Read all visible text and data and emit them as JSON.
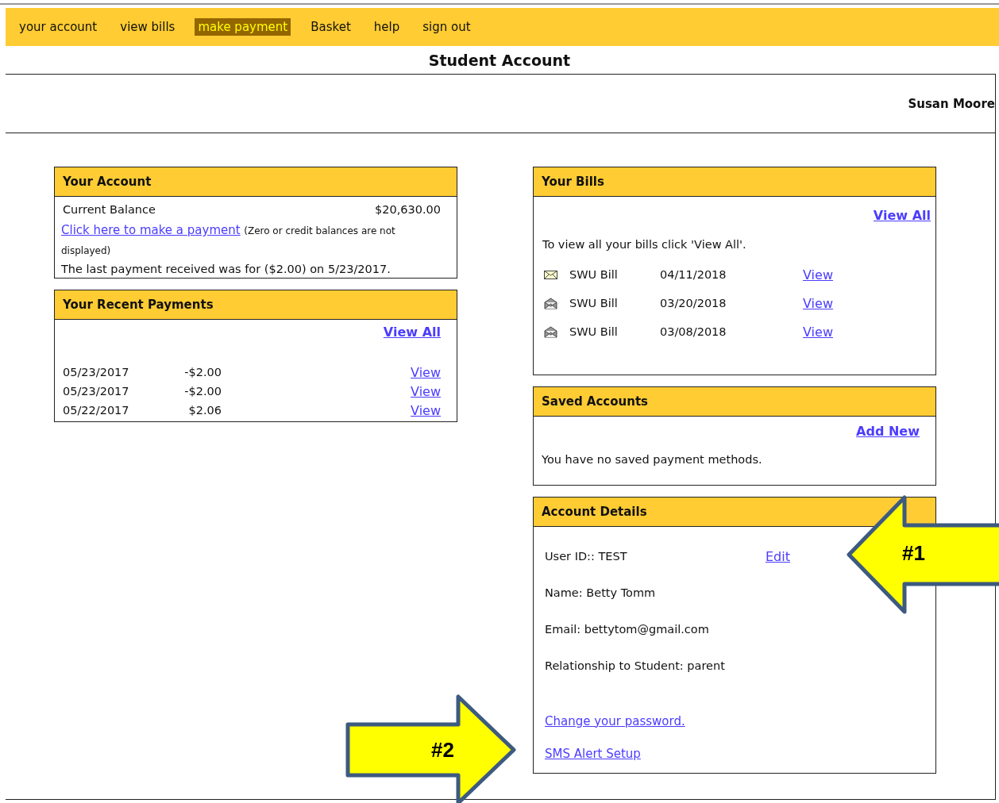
{
  "nav": [
    {
      "label": "your account",
      "selected": false
    },
    {
      "label": "view bills",
      "selected": false
    },
    {
      "label": "make payment",
      "selected": true
    },
    {
      "label": "Basket",
      "selected": false
    },
    {
      "label": "help",
      "selected": false
    },
    {
      "label": "sign out",
      "selected": false
    }
  ],
  "page_title": "Student Account",
  "user_name": "Susan Moore",
  "your_account": {
    "title": "Your Account",
    "balance_label": "Current Balance",
    "balance": "$20,630.00",
    "payment_link": "Click here to make a payment",
    "payment_note": "(Zero or credit balances are not displayed)",
    "last_payment": "The last payment received was for ($2.00) on 5/23/2017."
  },
  "recent_payments": {
    "title": "Your Recent Payments",
    "view_all": "View All",
    "rows": [
      {
        "date": "05/23/2017",
        "amount": "-$2.00",
        "link": "View"
      },
      {
        "date": "05/23/2017",
        "amount": "-$2.00",
        "link": "View"
      },
      {
        "date": "05/22/2017",
        "amount": "$2.06",
        "link": "View"
      }
    ]
  },
  "bills": {
    "title": "Your Bills",
    "view_all": "View All",
    "hint": "To view all your bills click 'View All'.",
    "rows": [
      {
        "opened": false,
        "name": "SWU Bill",
        "date": "04/11/2018",
        "link": "View"
      },
      {
        "opened": true,
        "name": "SWU Bill",
        "date": "03/20/2018",
        "link": "View"
      },
      {
        "opened": true,
        "name": "SWU Bill",
        "date": "03/08/2018",
        "link": "View"
      }
    ]
  },
  "saved_accounts": {
    "title": "Saved Accounts",
    "add_new": "Add New",
    "message": "You have no saved payment methods."
  },
  "account_details": {
    "title": "Account Details",
    "user_id": "User ID:: TEST",
    "edit": "Edit",
    "fields": [
      "Name: Betty Tomm",
      "Email: bettytom@gmail.com",
      "Relationship to Student: parent"
    ],
    "links": [
      "Change your password.",
      "SMS Alert Setup"
    ]
  },
  "callouts": [
    {
      "label": "#1",
      "kind": "left"
    },
    {
      "label": "#2",
      "kind": "right"
    }
  ]
}
